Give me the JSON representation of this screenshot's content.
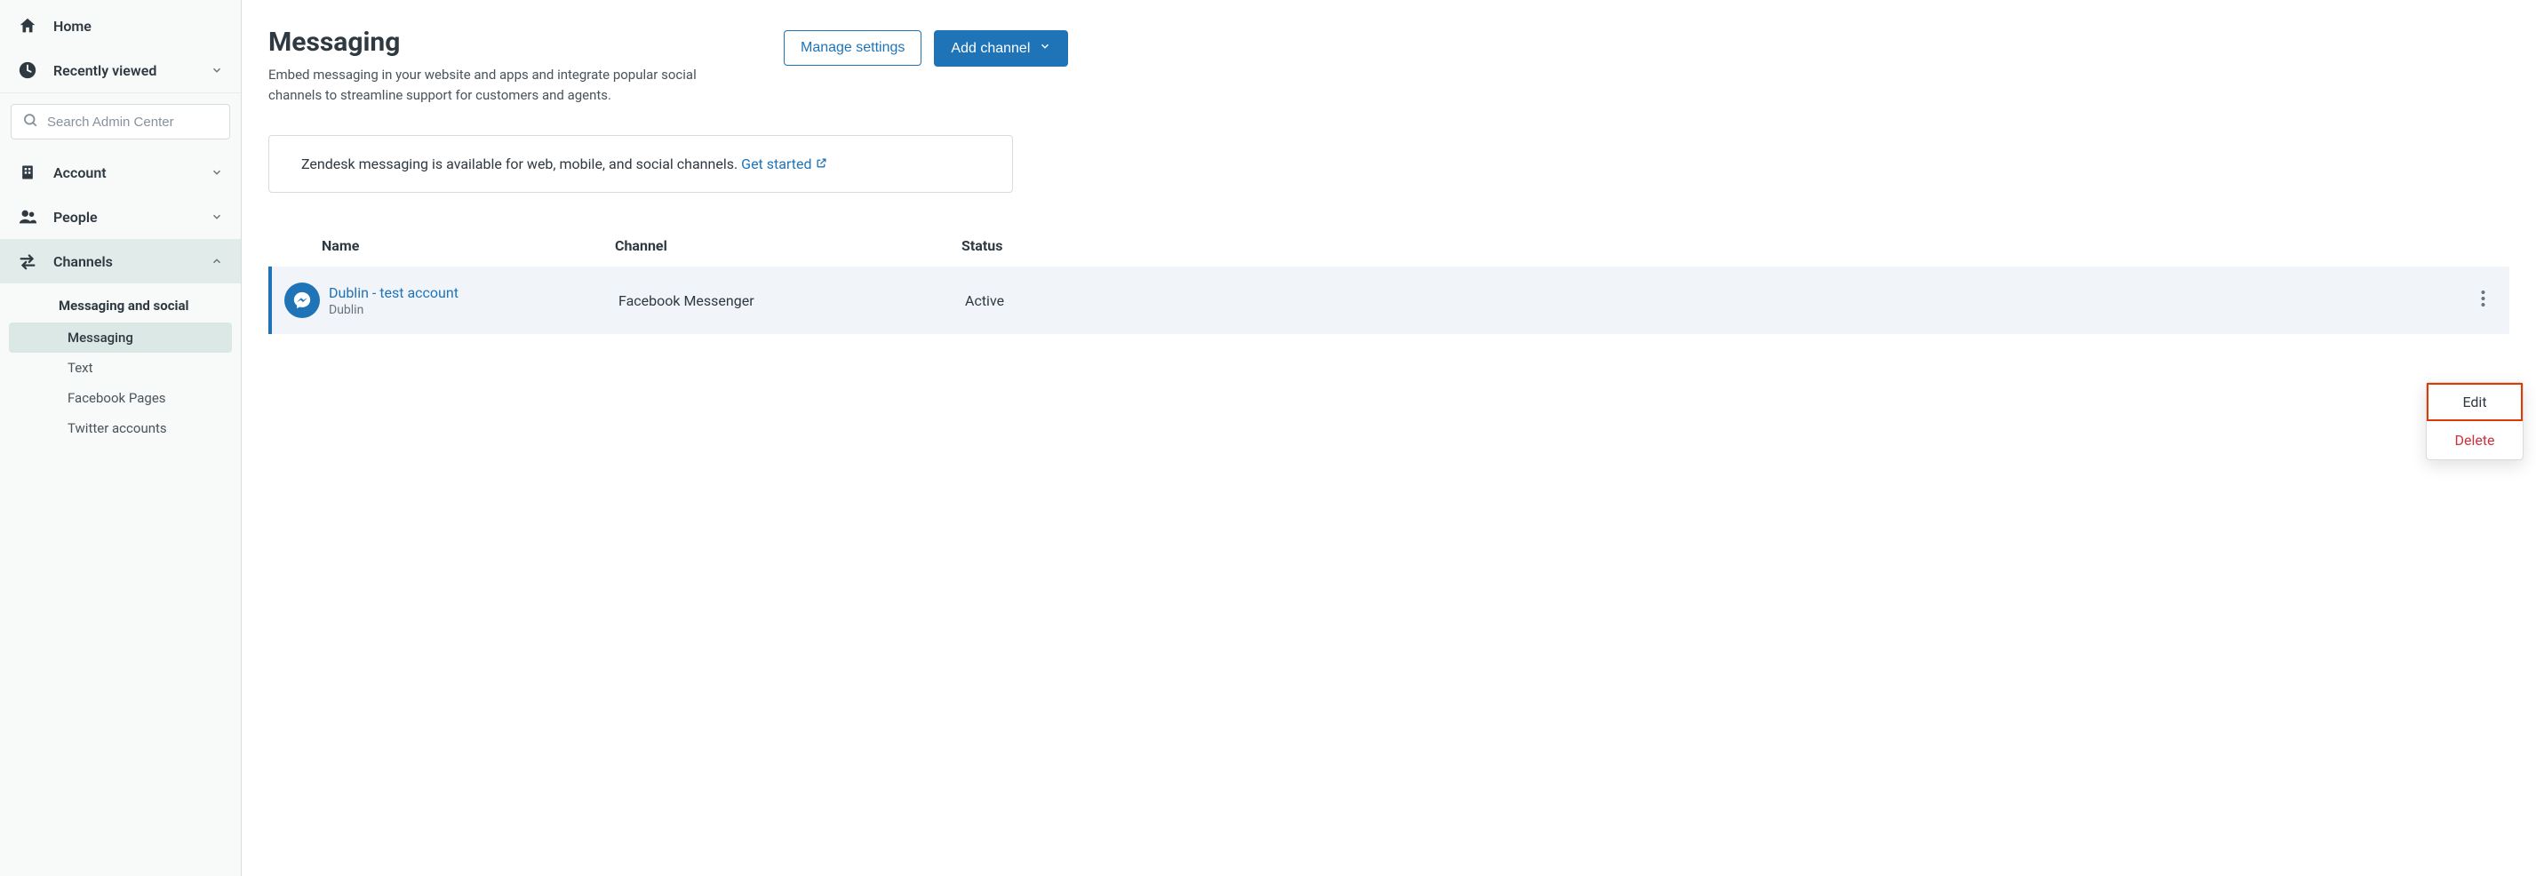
{
  "sidebar": {
    "home": "Home",
    "recently_viewed": "Recently viewed",
    "search_placeholder": "Search Admin Center",
    "account": "Account",
    "people": "People",
    "channels": "Channels",
    "sub_heading": "Messaging and social",
    "sub_items": {
      "messaging": "Messaging",
      "text": "Text",
      "facebook_pages": "Facebook Pages",
      "twitter_accounts": "Twitter accounts"
    }
  },
  "page": {
    "title": "Messaging",
    "description": "Embed messaging in your website and apps and integrate popular social channels to streamline support for customers and agents.",
    "manage_settings": "Manage settings",
    "add_channel": "Add channel"
  },
  "info": {
    "text": "Zendesk messaging is available for web, mobile, and social channels. ",
    "link": "Get started"
  },
  "table": {
    "headers": {
      "name": "Name",
      "channel": "Channel",
      "status": "Status"
    },
    "rows": [
      {
        "name": "Dublin - test account",
        "sub": "Dublin",
        "channel": "Facebook Messenger",
        "status": "Active"
      }
    ]
  },
  "menu": {
    "edit": "Edit",
    "delete": "Delete"
  }
}
